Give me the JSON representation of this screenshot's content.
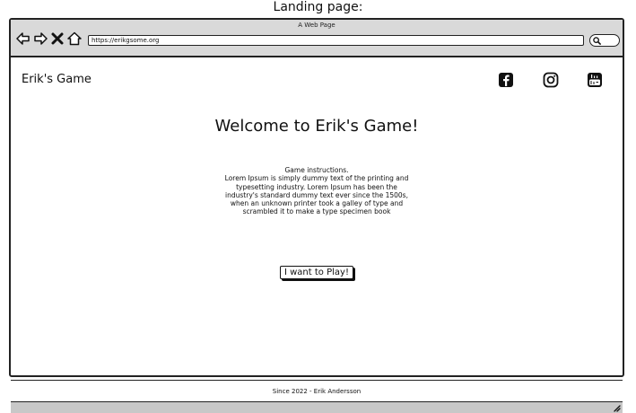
{
  "caption": "Landing page:",
  "browser": {
    "window_title": "A Web Page",
    "url": "https://erikgsome.org",
    "nav_icons": [
      "back-arrow-icon",
      "forward-arrow-icon",
      "stop-icon",
      "home-icon"
    ]
  },
  "site": {
    "title": "Erik's Game",
    "social_icons": [
      "facebook-icon",
      "instagram-icon",
      "youtube-icon"
    ]
  },
  "main": {
    "heading": "Welcome to Erik's Game!",
    "instructions_title": "Game instructions.",
    "instructions_body": "Lorem Ipsum is simply dummy text of the printing and typesetting industry. Lorem Ipsum has been the industry's standard dummy text ever since the 1500s, when an unknown printer took a galley of type and scrambled it to make a type specimen book",
    "play_button": "I want to Play!"
  },
  "footer": {
    "text": "Since 2022 - Erik Andersson"
  }
}
